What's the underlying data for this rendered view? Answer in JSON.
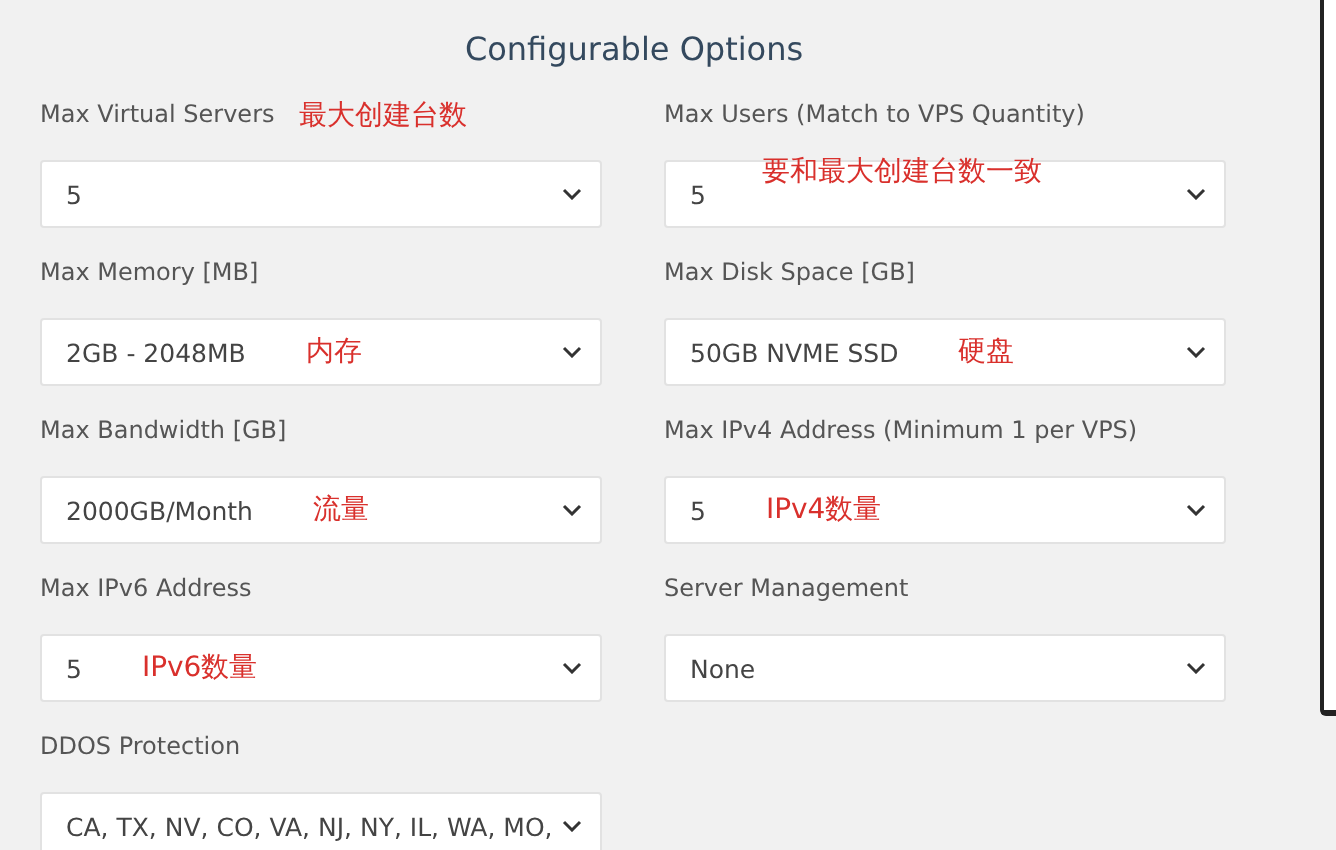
{
  "title": "Configurable Options",
  "fields": [
    {
      "label": "Max Virtual Servers",
      "value": "5",
      "note": {
        "text": "最大创建台数",
        "kind": "label"
      }
    },
    {
      "label": "Max Users (Match to VPS Quantity)",
      "value": "5",
      "note": {
        "text": "要和最大创建台数一致",
        "kind": "top"
      }
    },
    {
      "label": "Max Memory [MB]",
      "value": "2GB - 2048MB",
      "note": {
        "text": "内存",
        "kind": "field"
      }
    },
    {
      "label": "Max Disk Space [GB]",
      "value": "50GB NVME SSD",
      "note": {
        "text": "硬盘",
        "kind": "field"
      }
    },
    {
      "label": "Max Bandwidth [GB]",
      "value": "2000GB/Month",
      "note": {
        "text": "流量",
        "kind": "field"
      }
    },
    {
      "label": "Max IPv4 Address (Minimum 1 per VPS)",
      "value": "5",
      "note": {
        "text": "IPv4数量",
        "kind": "field"
      }
    },
    {
      "label": "Max IPv6 Address",
      "value": "5",
      "note": {
        "text": "IPv6数量",
        "kind": "field"
      }
    },
    {
      "label": "Server Management",
      "value": "None"
    },
    {
      "label": "DDOS Protection",
      "value": "CA, TX, NV, CO, VA, NJ, NY, IL, WA, MO,"
    }
  ]
}
